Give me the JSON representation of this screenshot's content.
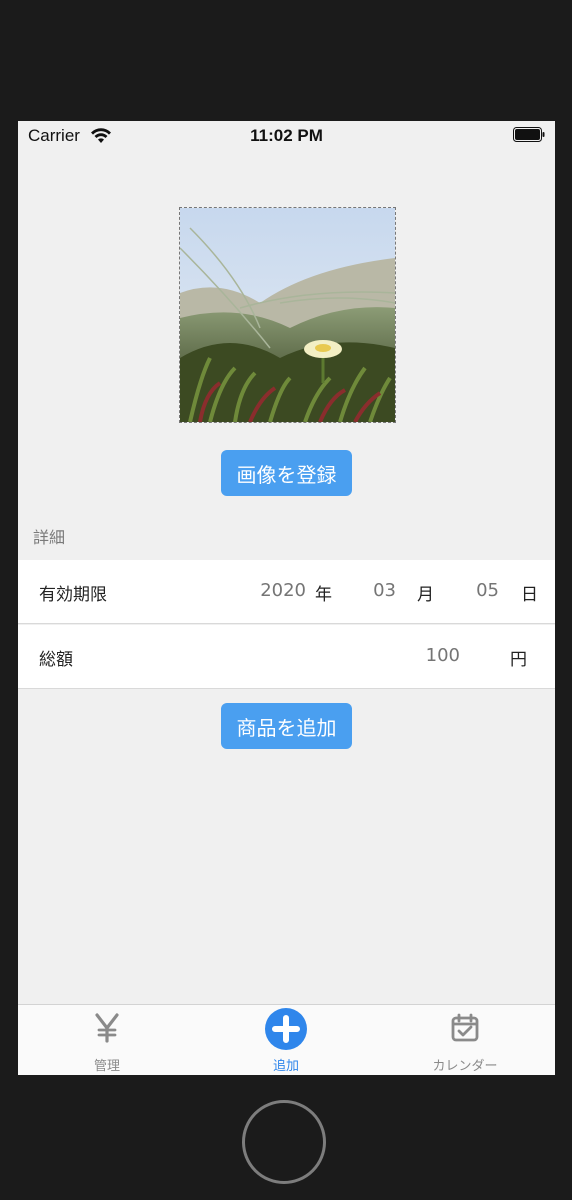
{
  "status_bar": {
    "carrier": "Carrier",
    "time": "11:02 PM"
  },
  "photo": {
    "description_icon": "flower-photo"
  },
  "register_image_button": "画像を登録",
  "details": {
    "section_title": "詳細",
    "expiry": {
      "label": "有効期限",
      "year_placeholder": "2020",
      "year_unit": "年",
      "month_placeholder": "03",
      "month_unit": "月",
      "day_placeholder": "05",
      "day_unit": "日"
    },
    "total": {
      "label": "総額",
      "amount_placeholder": "100",
      "amount_unit": "円"
    }
  },
  "add_item_button": "商品を追加",
  "tab_bar": {
    "items": [
      {
        "label": "管理",
        "icon": "yen-icon"
      },
      {
        "label": "追加",
        "icon": "plus-circle-icon",
        "active": true
      },
      {
        "label": "カレンダー",
        "icon": "calendar-check-icon"
      }
    ]
  },
  "colors": {
    "accent": "#4a9ff0",
    "tab_active": "#2f86eb",
    "background": "#f0f0f0",
    "device_frame": "#1b1b1b"
  }
}
